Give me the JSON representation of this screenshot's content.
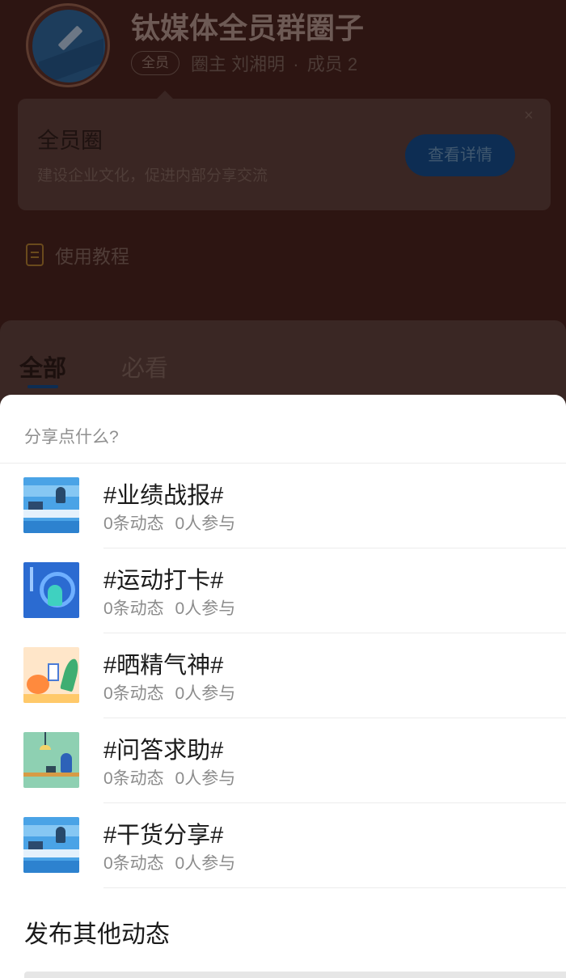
{
  "circle": {
    "title": "钛媒体全员群圈子",
    "badge": "全员",
    "owner": "圈主 刘湘明",
    "separator": "·",
    "members": "成员 2"
  },
  "intro_card": {
    "title": "全员圈",
    "description": "建设企业文化，促进内部分享交流",
    "detail_button": "查看详情",
    "close_icon": "×"
  },
  "tutorial": {
    "label": "使用教程",
    "icon": "document-icon",
    "icon_color": "#6a4a1c"
  },
  "tabs": [
    {
      "label": "全部",
      "active": true
    },
    {
      "label": "必看",
      "active": false
    }
  ],
  "sheet": {
    "prompt": "分享点什么?",
    "topics": [
      {
        "name": "#业绩战报#",
        "posts": "0条动态",
        "participants": "0人参与"
      },
      {
        "name": "#运动打卡#",
        "posts": "0条动态",
        "participants": "0人参与"
      },
      {
        "name": "#晒精气神#",
        "posts": "0条动态",
        "participants": "0人参与"
      },
      {
        "name": "#问答求助#",
        "posts": "0条动态",
        "participants": "0人参与"
      },
      {
        "name": "#干货分享#",
        "posts": "0条动态",
        "participants": "0人参与"
      }
    ],
    "publish_other": "发布其他动态"
  },
  "colors": {
    "accent": "#0d2d53",
    "overlay_background": "#2d1512",
    "sheet_background": "#ffffff",
    "muted_text": "#8c8c8c"
  }
}
